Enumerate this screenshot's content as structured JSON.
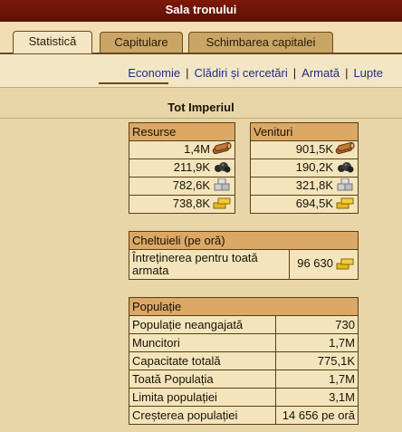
{
  "window": {
    "title": "Sala tronului"
  },
  "tabs": [
    {
      "label": "Statistică",
      "active": true
    },
    {
      "label": "Capitulare",
      "active": false
    },
    {
      "label": "Schimbarea capitalei",
      "active": false
    }
  ],
  "subnav": [
    "Economie",
    "Clădiri și cercetări",
    "Armată",
    "Lupte"
  ],
  "section_title": "Tot Imperiul",
  "resources": {
    "header": "Resurse",
    "rows": [
      {
        "value": "1,4M",
        "icon": "wood-icon"
      },
      {
        "value": "211,9K",
        "icon": "coal-icon"
      },
      {
        "value": "782,6K",
        "icon": "stone-icon"
      },
      {
        "value": "738,8K",
        "icon": "gold-icon"
      }
    ]
  },
  "income": {
    "header": "Venituri",
    "rows": [
      {
        "value": "901,5K",
        "icon": "wood-icon"
      },
      {
        "value": "190,2K",
        "icon": "coal-icon"
      },
      {
        "value": "321,8K",
        "icon": "stone-icon"
      },
      {
        "value": "694,5K",
        "icon": "gold-icon"
      }
    ]
  },
  "expenses": {
    "header": "Cheltuieli (pe oră)",
    "label": "Întreținerea pentru toată armata",
    "value": "96 630",
    "icon": "gold-icon"
  },
  "population": {
    "header": "Populație",
    "rows": [
      {
        "label": "Populație neangajată",
        "value": "730"
      },
      {
        "label": "Muncitori",
        "value": "1,7M"
      },
      {
        "label": "Capacitate totală",
        "value": "775,1K"
      },
      {
        "label": "Toată Populația",
        "value": "1,7M"
      },
      {
        "label": "Limita populației",
        "value": "3,1M"
      },
      {
        "label": "Creșterea populației",
        "value": "14 656 pe oră"
      }
    ]
  },
  "colors": {
    "titlebar": "#6b1406",
    "background": "#f1dfb3",
    "table_header": "#dba865",
    "link": "#1f2d8a"
  }
}
